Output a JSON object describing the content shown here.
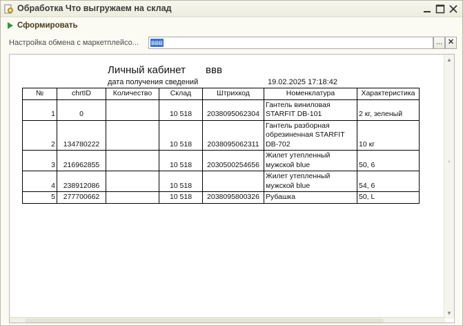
{
  "window": {
    "title": "Обработка  Что выгружаем на склад",
    "controls": [
      "minimize-icon",
      "maximize-icon",
      "close-icon"
    ]
  },
  "toolbar": {
    "generate_label": "Сформировать"
  },
  "settings": {
    "label": "Настройка обмена с маркетплейсо...",
    "value": "ввв",
    "select_label": "...",
    "clear_label": "✕"
  },
  "report": {
    "title": "Личный кабинет",
    "cabinet_name": "ввв",
    "date_label": "дата получения сведений",
    "date_value": "19.02.2025 17:18:42",
    "columns": [
      "№",
      "chrtID",
      "Количество",
      "Склад",
      "Штрихкод",
      "Номенклатура",
      "Характеристика"
    ],
    "rows": [
      {
        "no": "1",
        "chrtid": "0",
        "qty": "",
        "warehouse": "10 518",
        "barcode": "2038095062304",
        "nom": "Гантель виниловая STARFIT DB-101",
        "char": "2 кг, зеленый"
      },
      {
        "no": "2",
        "chrtid": "134780222",
        "qty": "",
        "warehouse": "10 518",
        "barcode": "2038095062311",
        "nom": "Гантель разборная обрезиненная STARFIT DB-702",
        "char": "10 кг"
      },
      {
        "no": "3",
        "chrtid": "216962855",
        "qty": "",
        "warehouse": "10 518",
        "barcode": "2030500254656",
        "nom": "Жилет утепленный мужской blue",
        "char": "50, 6"
      },
      {
        "no": "4",
        "chrtid": "238912086",
        "qty": "",
        "warehouse": "10 518",
        "barcode": "",
        "nom": "Жилет утепленный мужской blue",
        "char": "54, 6"
      },
      {
        "no": "5",
        "chrtid": "277700662",
        "qty": "",
        "warehouse": "10 518",
        "barcode": "2038095800326",
        "nom": "Рубашка",
        "char": "50, L"
      }
    ]
  },
  "colors": {
    "accent_green": "#2e9b2e",
    "selection_blue": "#3b73d1",
    "window_bg": "#fbfbf4"
  }
}
